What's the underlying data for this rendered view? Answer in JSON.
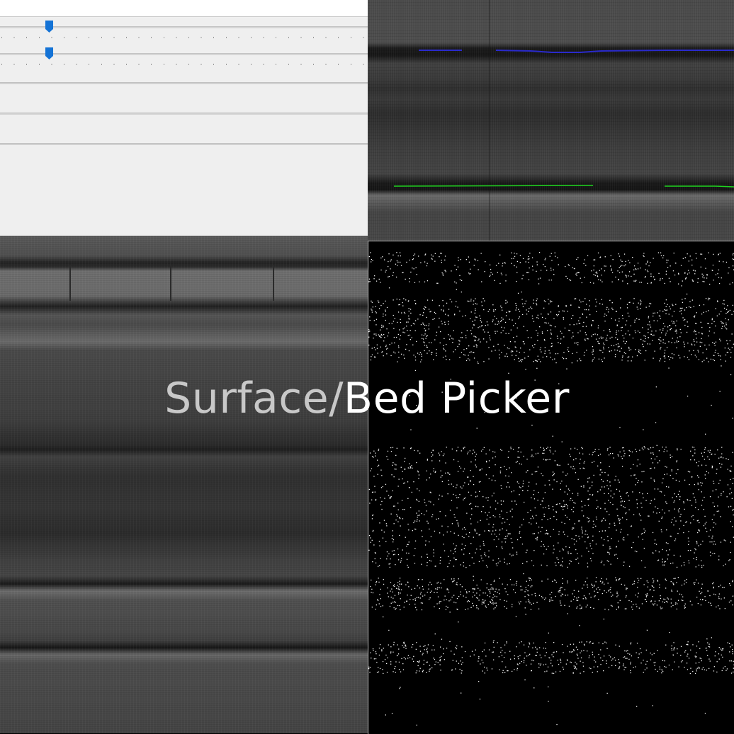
{
  "title": {
    "part1": "Surface/",
    "part2": "Bed Picker"
  },
  "sliders": [
    {
      "name": "slider-1",
      "value": 0.13
    },
    {
      "name": "slider-2",
      "value": 0.13
    }
  ],
  "colors": {
    "surface_pick": "#2a2acc",
    "bed_pick": "#1fd41f",
    "slider_thumb": "#1473d6",
    "panel_bg": "#efefef"
  },
  "icons": [
    "slider-thumb-icon"
  ]
}
